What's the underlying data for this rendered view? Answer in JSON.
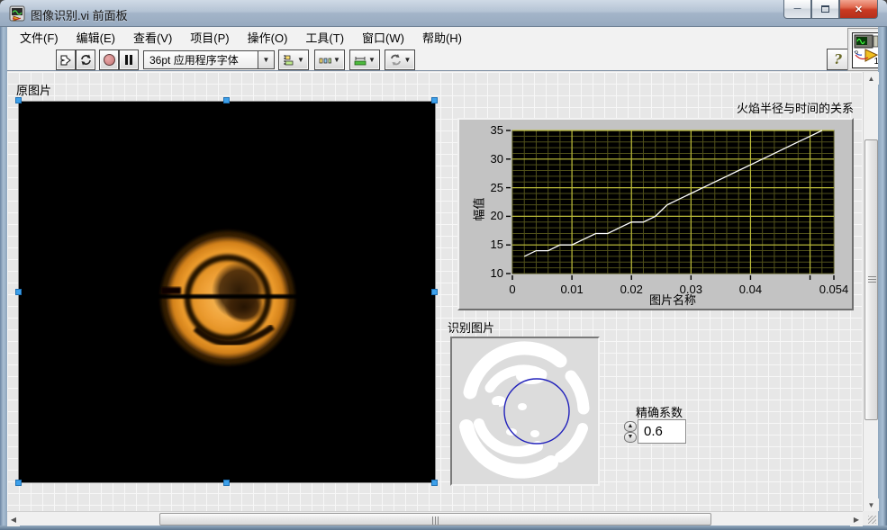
{
  "window": {
    "title": "图像识别.vi 前面板",
    "minimize": "─",
    "close": "✕"
  },
  "menu": {
    "items": [
      "文件(F)",
      "编辑(E)",
      "查看(V)",
      "项目(P)",
      "操作(O)",
      "工具(T)",
      "窗口(W)",
      "帮助(H)"
    ]
  },
  "toolbar": {
    "font_selector": "36pt 应用程序字体",
    "dropdown_glyph": "▼",
    "help_label": "?",
    "vi_badge": "1"
  },
  "panel": {
    "original_image_label": "原图片",
    "recognized_image_label": "识别图片",
    "precision_label": "精确系数",
    "precision_value": "0.6",
    "spinner_up": "▲",
    "spinner_down": "▼"
  },
  "colors": {
    "selection_handle": "#3da0ea",
    "recognition_circle": "#2222bb",
    "flame_orange": "#f2a132"
  },
  "chart_data": {
    "type": "line",
    "title": "火焰半径与时间的关系",
    "xlabel": "图片名称",
    "ylabel": "幅值",
    "xlim": [
      0,
      0.054
    ],
    "ylim": [
      10,
      35
    ],
    "xticks": [
      {
        "v": 0,
        "label": "0"
      },
      {
        "v": 0.01,
        "label": "0.01"
      },
      {
        "v": 0.02,
        "label": "0.02"
      },
      {
        "v": 0.03,
        "label": "0.03"
      },
      {
        "v": 0.04,
        "label": "0.04"
      },
      {
        "v": 0.05,
        "label": ""
      },
      {
        "v": 0.054,
        "label": "0.054"
      }
    ],
    "yticks": [
      10,
      15,
      20,
      25,
      30,
      35
    ],
    "x_minor_step": 0.002,
    "y_minor_step": 1,
    "x_major_step": 0.01,
    "y_major_step": 5,
    "grid": {
      "plot_bg": "#000000",
      "minor_color": "#50501a",
      "major_color": "#bcbc3a"
    },
    "line_color": "#ffffff",
    "legend": "none",
    "series": [
      {
        "name": "火焰半径",
        "x": [
          0.002,
          0.004,
          0.006,
          0.008,
          0.01,
          0.012,
          0.014,
          0.016,
          0.018,
          0.02,
          0.022,
          0.024,
          0.026,
          0.028,
          0.03,
          0.032,
          0.034,
          0.036,
          0.038,
          0.04,
          0.042,
          0.044,
          0.046,
          0.048,
          0.05,
          0.052
        ],
        "y": [
          13,
          14,
          14,
          15,
          15,
          16,
          17,
          17,
          18,
          19,
          19,
          20,
          22,
          23,
          24,
          25,
          26,
          27,
          28,
          29,
          30,
          31,
          32,
          33,
          34,
          35
        ]
      }
    ]
  }
}
